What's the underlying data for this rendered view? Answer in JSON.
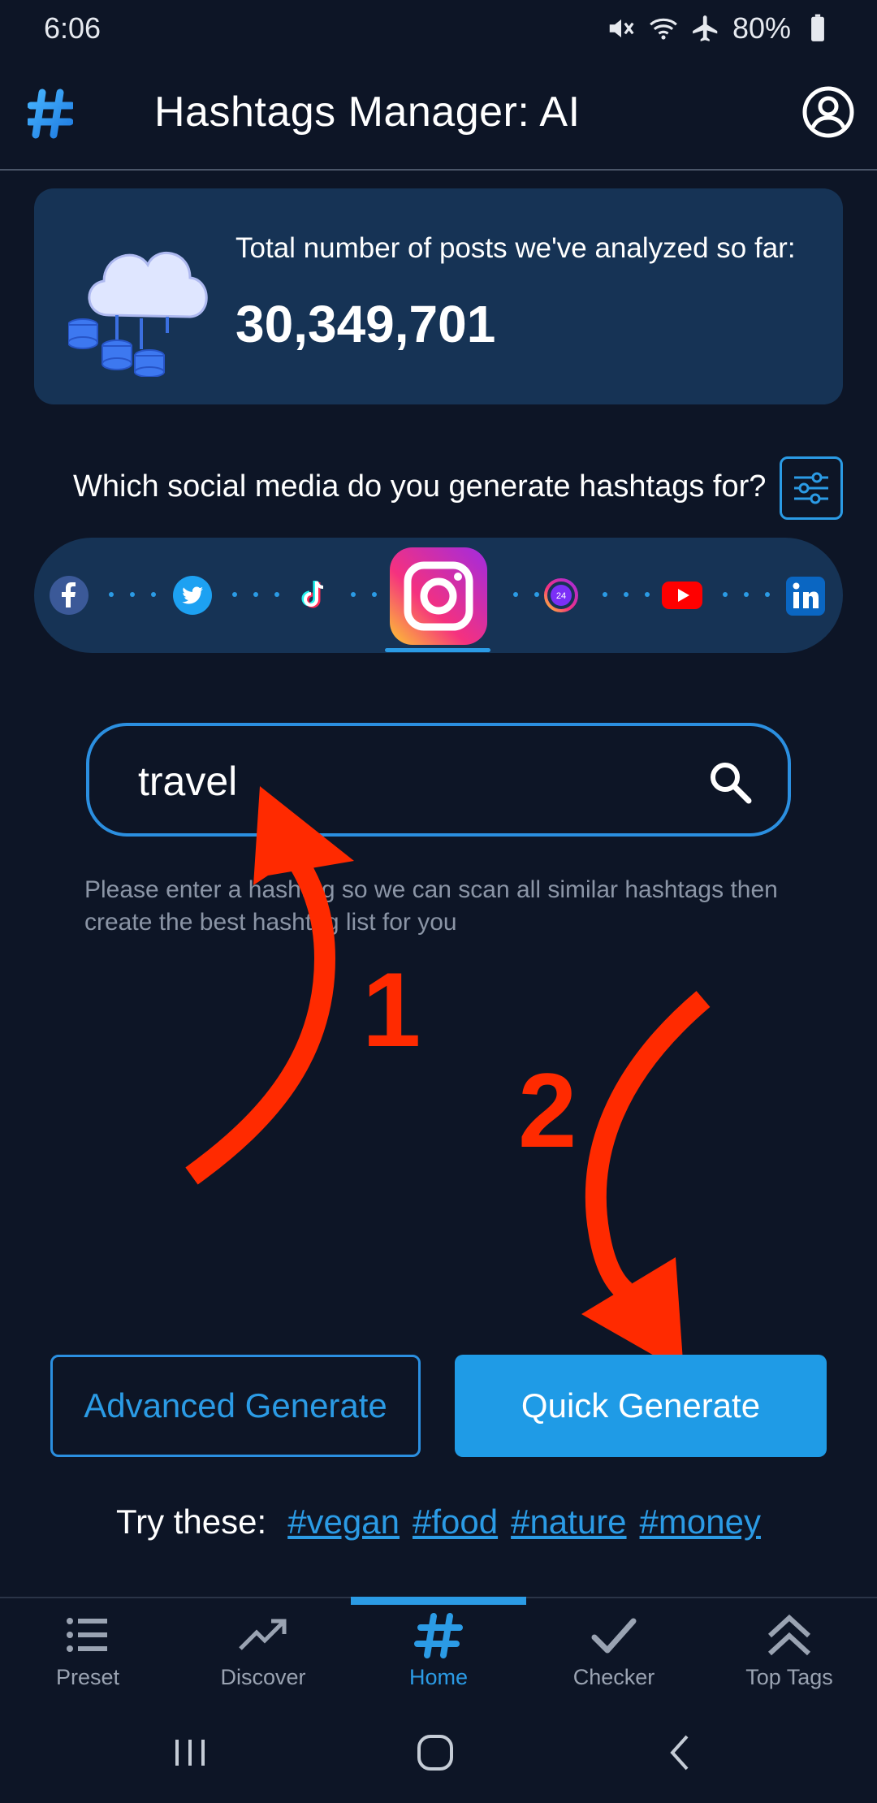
{
  "status": {
    "time": "6:06",
    "battery": "80%"
  },
  "appbar": {
    "title": "Hashtags Manager: AI"
  },
  "stats": {
    "label": "Total number of posts we've analyzed so far:",
    "value": "30,349,701"
  },
  "question": "Which social media do you generate hashtags for?",
  "social": {
    "items": [
      "facebook",
      "twitter",
      "tiktok",
      "instagram",
      "instagram-reels",
      "youtube",
      "linkedin"
    ],
    "selected": "instagram"
  },
  "search": {
    "value": "travel"
  },
  "helper": "Please enter a hashtag so we can scan all similar hashtags then create the best hashtag list for you",
  "annotations": {
    "one": "1",
    "two": "2"
  },
  "buttons": {
    "advanced": "Advanced Generate",
    "quick": "Quick Generate"
  },
  "try": {
    "label": "Try these:",
    "tags": [
      "#vegan",
      "#food",
      "#nature",
      "#money"
    ]
  },
  "nav": {
    "preset": "Preset",
    "discover": "Discover",
    "home": "Home",
    "checker": "Checker",
    "top_tags": "Top Tags",
    "active": "Home"
  },
  "colors": {
    "background": "#0d1526",
    "card": "#163355",
    "accent": "#2b9be5",
    "annotation": "#ff2a00"
  }
}
